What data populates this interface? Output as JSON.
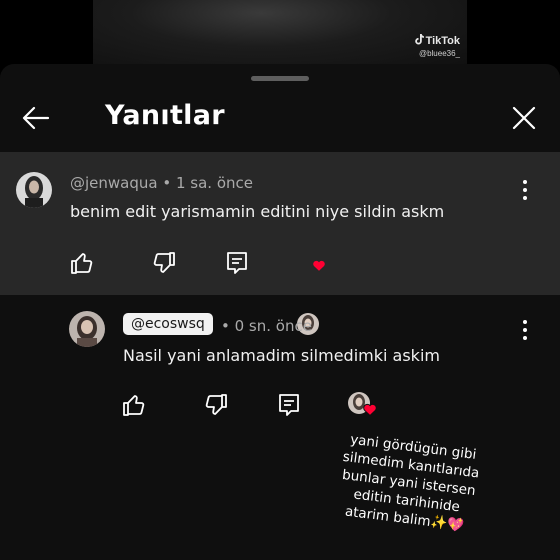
{
  "video": {
    "watermark_brand": "TikTok",
    "watermark_user": "@bluee36_"
  },
  "header": {
    "title": "Yanıtlar",
    "back_icon": "arrow-left-icon",
    "close_icon": "close-icon"
  },
  "parent_comment": {
    "username": "@jenwaqua",
    "separator": " • ",
    "time": "1 sa. önce",
    "text": "benim edit yarismamin editini niye sildin askm",
    "actions": [
      "like-icon",
      "dislike-icon",
      "reply-icon"
    ],
    "creator_heart": true
  },
  "reply_comment": {
    "mention": "@ecoswsq",
    "separator": " • ",
    "time": "0 sn. önce",
    "text": "Nasil yani anlamadim silmedimki askim",
    "actions": [
      "like-icon",
      "dislike-icon",
      "reply-icon"
    ],
    "creator_heart": true
  },
  "overlay_text": {
    "lines": [
      "yani gördügün gibi",
      "silmedim kanıtlarıda",
      "bunlar yani istersen",
      "editin tarihinide",
      "atarim balim✨💖"
    ]
  },
  "colors": {
    "sheet_bg": "#0f0f0f",
    "highlight_bg": "#282828",
    "meta_text": "#aaaaaa",
    "heart": "#ff0033"
  }
}
